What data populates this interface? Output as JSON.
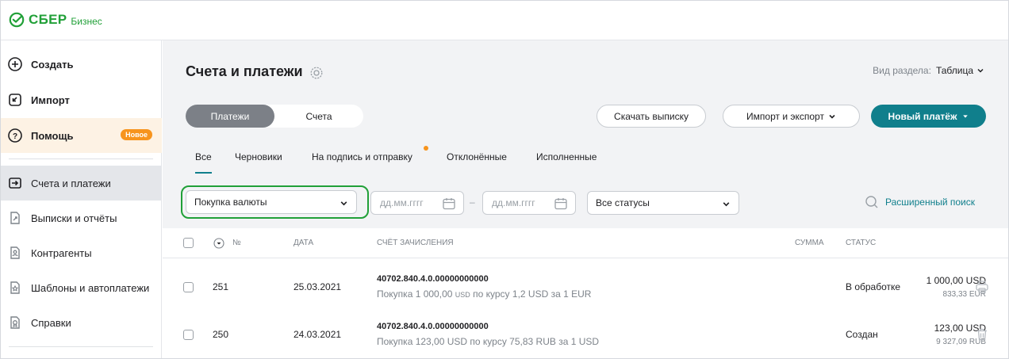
{
  "header": {
    "brand": "СБЕР",
    "brand_sub": "Бизнес"
  },
  "sidebar": {
    "items": [
      {
        "label": "Создать",
        "icon": "plus-circle-icon"
      },
      {
        "label": "Импорт",
        "icon": "import-icon"
      },
      {
        "label": "Помощь",
        "icon": "help-icon",
        "badge": "Новое"
      },
      {
        "label": "Счета и платежи",
        "icon": "payments-icon"
      },
      {
        "label": "Выписки и отчёты",
        "icon": "statements-icon"
      },
      {
        "label": "Контрагенты",
        "icon": "contractors-icon"
      },
      {
        "label": "Шаблоны и автоплатежи",
        "icon": "templates-icon"
      },
      {
        "label": "Справки",
        "icon": "certificates-icon"
      }
    ]
  },
  "main": {
    "title": "Счета и платежи",
    "view_mode_label": "Вид раздела:",
    "view_mode_value": "Таблица",
    "segment": {
      "active": "Платежи",
      "inactive": "Счета"
    },
    "buttons": {
      "download": "Скачать выписку",
      "import_export": "Импорт и экспорт",
      "new_payment": "Новый платёж"
    },
    "tabs": [
      "Все",
      "Черновики",
      "На подпись и отправку",
      "Отклонённые",
      "Исполненные"
    ],
    "filters": {
      "type": "Покупка валюты",
      "date_from_placeholder": "дд.мм.гггг",
      "date_to_placeholder": "дд.мм.гггг",
      "status": "Все статусы",
      "advanced_search": "Расширенный поиск"
    },
    "table": {
      "columns": [
        "№",
        "ДАТА",
        "СЧЁТ ЗАЧИСЛЕНИЯ",
        "СУММА",
        "СТАТУС"
      ],
      "rows": [
        {
          "number": "251",
          "date": "25.03.2021",
          "account": "40702.840.4.0.00000000000",
          "desc_a": "Покупка 1 000,00",
          "desc_cur": "USD",
          "desc_b": "по курсу 1,2 USD за 1 EUR",
          "amount": "1 000,00 USD",
          "amount_sub": "833,33 EUR",
          "status": "В обработке",
          "action_icon": "print-icon"
        },
        {
          "number": "250",
          "date": "24.03.2021",
          "account": "40702.840.4.0.00000000000",
          "desc_a": "Покупка 123,00 USD по курсу 75,83 RUB за 1 USD",
          "desc_cur": "",
          "desc_b": "",
          "amount": "123,00 USD",
          "amount_sub": "9 327,09 RUB",
          "status": "Создан",
          "action_icon": "trash-icon"
        }
      ]
    }
  },
  "colors": {
    "brand": "#21a038",
    "accent": "#107f8c",
    "badge": "#f7941d"
  }
}
